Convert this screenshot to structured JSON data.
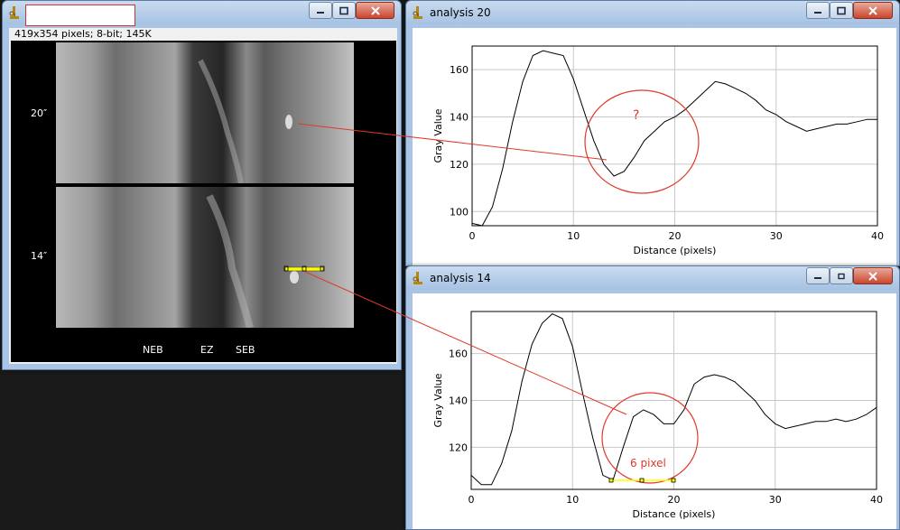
{
  "image_window": {
    "title": "",
    "info": "419x354 pixels; 8-bit; 145K",
    "labels": {
      "upper": "20″",
      "lower": "14″",
      "neb": "NEB",
      "ez": "EZ",
      "seb": "SEB"
    }
  },
  "plot20": {
    "title": "analysis 20",
    "annotation": "?"
  },
  "plot14": {
    "title": "analysis 14",
    "annotation": "6 pixel"
  },
  "colors": {
    "annotation": "#e0392a",
    "selection": "#ffff00",
    "title_bar": "#b7cfec"
  },
  "chart_data": [
    {
      "type": "line",
      "title": "",
      "xlabel": "Distance (pixels)",
      "ylabel": "Gray Value",
      "xlim": [
        0,
        40
      ],
      "ylim": [
        94,
        170
      ],
      "xticks": [
        0,
        10,
        20,
        30,
        40
      ],
      "yticks": [
        100,
        120,
        140,
        160
      ],
      "grid": true,
      "x": [
        0,
        1,
        2,
        3,
        4,
        5,
        6,
        7,
        8,
        9,
        10,
        11,
        12,
        13,
        14,
        15,
        16,
        17,
        18,
        19,
        20,
        21,
        22,
        23,
        24,
        25,
        26,
        27,
        28,
        29,
        30,
        31,
        32,
        33,
        34,
        35,
        36,
        37,
        38,
        39,
        40
      ],
      "y": [
        95,
        94,
        102,
        118,
        138,
        155,
        166,
        168,
        167,
        166,
        156,
        143,
        130,
        120,
        115,
        117,
        123,
        130,
        134,
        138,
        140,
        143,
        147,
        151,
        155,
        154,
        152,
        150,
        147,
        143,
        141,
        138,
        136,
        134,
        135,
        136,
        137,
        137,
        138,
        139,
        139
      ]
    },
    {
      "type": "line",
      "title": "",
      "xlabel": "Distance (pixels)",
      "ylabel": "Gray Value",
      "xlim": [
        0,
        40
      ],
      "ylim": [
        102,
        178
      ],
      "xticks": [
        0,
        10,
        20,
        30,
        40
      ],
      "yticks": [
        120,
        140,
        160
      ],
      "grid": true,
      "x": [
        0,
        1,
        2,
        3,
        4,
        5,
        6,
        7,
        8,
        9,
        10,
        11,
        12,
        13,
        14,
        15,
        16,
        17,
        18,
        19,
        20,
        21,
        22,
        23,
        24,
        25,
        26,
        27,
        28,
        29,
        30,
        31,
        32,
        33,
        34,
        35,
        36,
        37,
        38,
        39,
        40
      ],
      "y": [
        108,
        104,
        104,
        113,
        127,
        148,
        164,
        173,
        177,
        175,
        163,
        143,
        124,
        108,
        106,
        120,
        133,
        136,
        134,
        130,
        130,
        136,
        147,
        150,
        151,
        150,
        148,
        144,
        140,
        134,
        130,
        128,
        129,
        130,
        131,
        131,
        132,
        131,
        132,
        134,
        137
      ]
    }
  ]
}
